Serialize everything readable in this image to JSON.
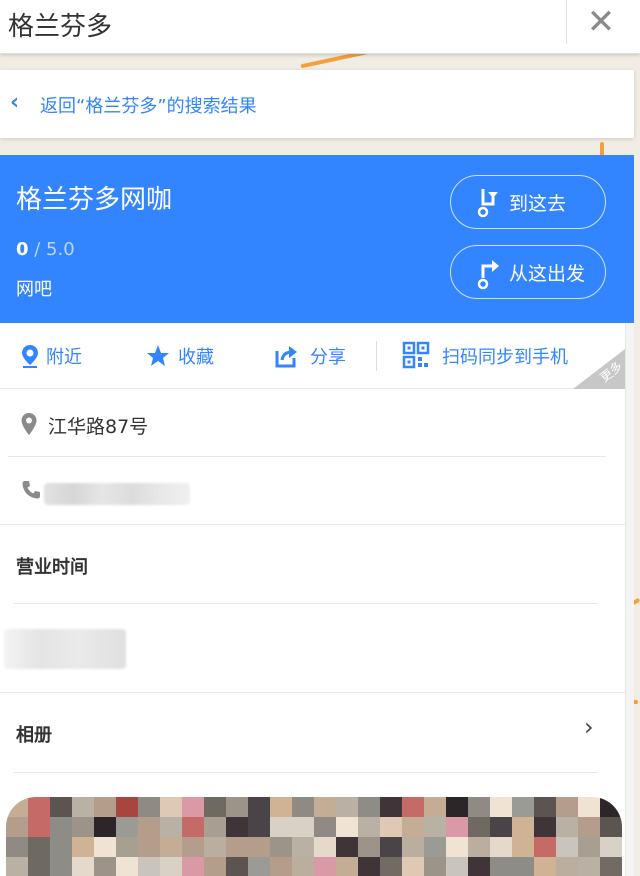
{
  "search": {
    "value": "格兰芬多",
    "clear_icon": "close-icon"
  },
  "back": {
    "label": "返回“格兰芬多”的搜索结果",
    "icon": "chevron-left-icon"
  },
  "place": {
    "name": "格兰芬多网咖",
    "rating": "0",
    "rating_max": " / 5.0",
    "category": "网吧",
    "go_here_label": "到这去",
    "start_here_label": "从这出发"
  },
  "actions": [
    {
      "label": "附近",
      "icon": "location-pin-icon"
    },
    {
      "label": "收藏",
      "icon": "star-icon"
    },
    {
      "label": "分享",
      "icon": "share-icon"
    },
    {
      "label": "扫码同步到手机",
      "icon": "qr-code-icon"
    }
  ],
  "more_label": "更多",
  "details": {
    "address": "江华路87号",
    "phone": "",
    "hours_title": "营业时间",
    "album_title": "相册"
  },
  "colors": {
    "accent": "#3385ff",
    "map_road": "#f0a13c",
    "map_bg": "#f1ede4"
  }
}
